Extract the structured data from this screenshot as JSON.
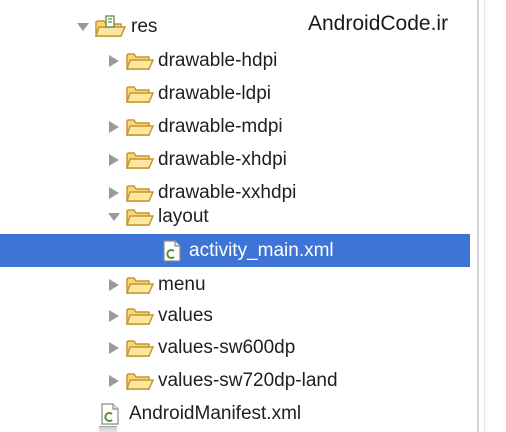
{
  "watermark": "AndroidCode.ir",
  "tree": [
    {
      "label": "res",
      "icon": "res-folder-icon",
      "expanded": true
    },
    {
      "label": "drawable-hdpi",
      "icon": "folder-icon",
      "expanded": false
    },
    {
      "label": "drawable-ldpi",
      "icon": "folder-icon"
    },
    {
      "label": "drawable-mdpi",
      "icon": "folder-icon",
      "expanded": false
    },
    {
      "label": "drawable-xhdpi",
      "icon": "folder-icon",
      "expanded": false
    },
    {
      "label": "drawable-xxhdpi",
      "icon": "folder-icon",
      "expanded": false
    },
    {
      "label": "layout",
      "icon": "folder-icon",
      "expanded": true
    },
    {
      "label": "activity_main.xml",
      "icon": "xml-file-icon",
      "selected": true
    },
    {
      "label": "menu",
      "icon": "folder-icon",
      "expanded": false
    },
    {
      "label": "values",
      "icon": "folder-icon",
      "expanded": false
    },
    {
      "label": "values-sw600dp",
      "icon": "folder-icon",
      "expanded": false
    },
    {
      "label": "values-sw720dp-land",
      "icon": "folder-icon",
      "expanded": false
    },
    {
      "label": "AndroidManifest.xml",
      "icon": "xml-file-icon"
    }
  ],
  "colors": {
    "selection": "#3d74d6",
    "folder_fill": "#f7d77a",
    "folder_stroke": "#c8962c",
    "arrow": "#9a9a9a",
    "file_badge": "#5b8f3e"
  }
}
